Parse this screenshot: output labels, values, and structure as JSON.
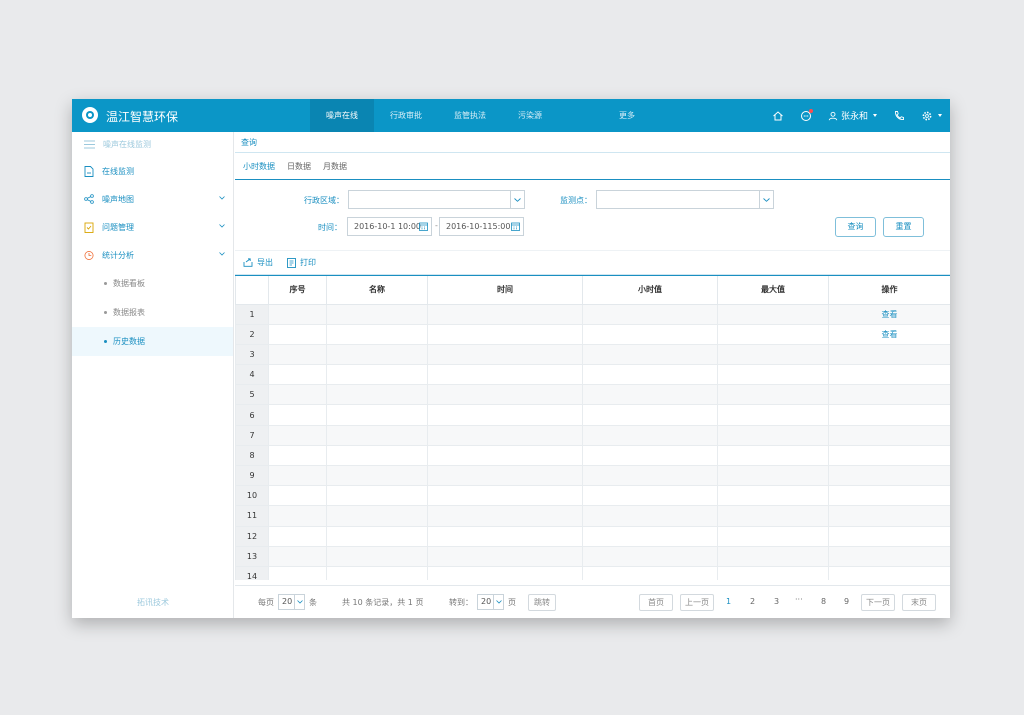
{
  "app": {
    "title": "温江智慧环保"
  },
  "nav": {
    "items": [
      "噪声在线",
      "行政审批",
      "监管执法",
      "污染源"
    ],
    "active": "噪声在线",
    "more": "更多"
  },
  "user": {
    "name": "张永和"
  },
  "sidebar": {
    "header": "噪声在线监测",
    "items": [
      {
        "label": "在线监测",
        "icon": "monitor-doc-icon"
      },
      {
        "label": "噪声地图",
        "icon": "share-nodes-icon"
      },
      {
        "label": "问题管理",
        "icon": "clipboard-icon"
      },
      {
        "label": "统计分析",
        "icon": "clock-chart-icon"
      }
    ],
    "subitems": [
      "数据看板",
      "数据报表",
      "历史数据"
    ],
    "active_sub": "历史数据",
    "footer": "拓讯技术"
  },
  "breadcrumb": "查询",
  "tabs": [
    "小时数据",
    "日数据",
    "月数据"
  ],
  "active_tab": "小时数据",
  "filter": {
    "region_label": "行政区域：",
    "point_label": "监测点：",
    "time_label": "时间：",
    "start_time": "2016-10-1 10:00",
    "end_time": "2016-10-115:00",
    "range_sep": "-",
    "query_button": "查询",
    "reset_button": "重置"
  },
  "toolbar": {
    "export": "导出",
    "print": "打印"
  },
  "table": {
    "columns": [
      "序号",
      "名称",
      "时间",
      "小时值",
      "最大值",
      "操作"
    ],
    "row_indexes": [
      "1",
      "2",
      "3",
      "4",
      "5",
      "6",
      "7",
      "8",
      "9",
      "10",
      "11",
      "12",
      "13",
      "14"
    ],
    "rows": [
      [
        "",
        "",
        "",
        "",
        "",
        "查看"
      ],
      [
        "",
        "",
        "",
        "",
        "",
        "查看"
      ],
      [
        "",
        "",
        "",
        "",
        "",
        ""
      ],
      [
        "",
        "",
        "",
        "",
        "",
        ""
      ],
      [
        "",
        "",
        "",
        "",
        "",
        ""
      ],
      [
        "",
        "",
        "",
        "",
        "",
        ""
      ],
      [
        "",
        "",
        "",
        "",
        "",
        ""
      ],
      [
        "",
        "",
        "",
        "",
        "",
        ""
      ],
      [
        "",
        "",
        "",
        "",
        "",
        ""
      ],
      [
        "",
        "",
        "",
        "",
        "",
        ""
      ],
      [
        "",
        "",
        "",
        "",
        "",
        ""
      ],
      [
        "",
        "",
        "",
        "",
        "",
        ""
      ],
      [
        "",
        "",
        "",
        "",
        "",
        ""
      ],
      [
        "",
        "",
        "",
        "",
        "",
        ""
      ]
    ]
  },
  "pager": {
    "per_page_prefix": "每页",
    "per_page_value": "20",
    "per_page_suffix": "条",
    "summary": "共 10 条记录，共 1 页",
    "jump_prefix": "转到：",
    "jump_value": "20",
    "jump_suffix": "页",
    "jump_button": "跳转",
    "first": "首页",
    "prev": "上一页",
    "pages": [
      "1",
      "2",
      "3",
      "···",
      "8",
      "9"
    ],
    "current": "1",
    "next": "下一页",
    "last": "末页"
  },
  "colors": {
    "brand": "#0b96c7",
    "accent": "#1a8fc1"
  }
}
